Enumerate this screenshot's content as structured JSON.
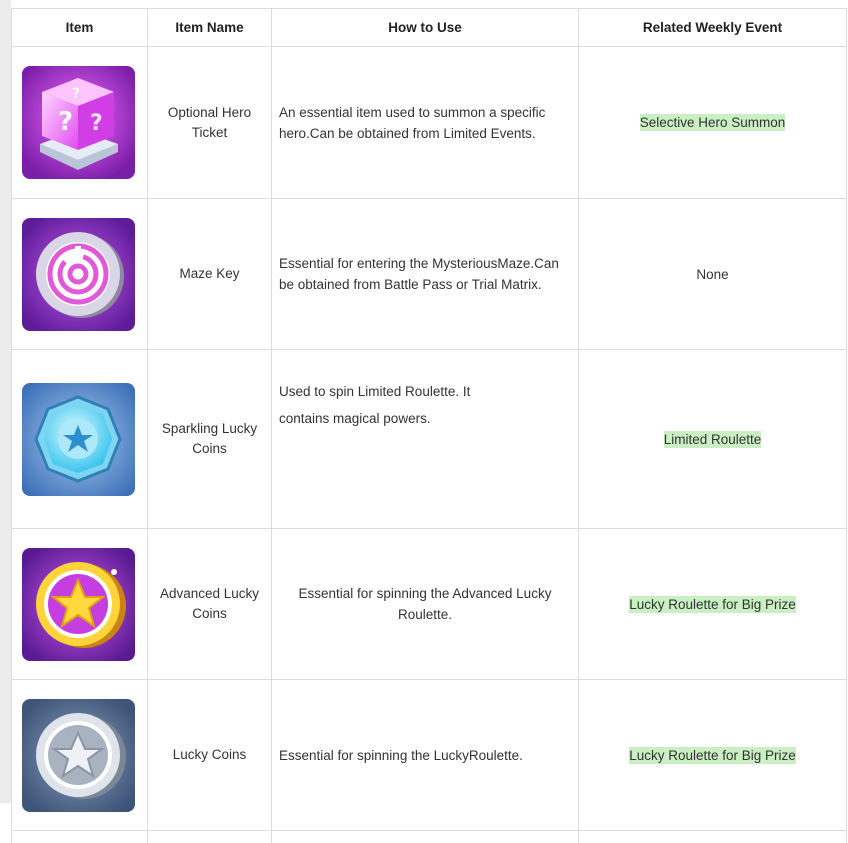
{
  "headers": {
    "item": "Item",
    "item_name": "Item Name",
    "how_to_use": "How to Use",
    "related_event": "Related Weekly Event"
  },
  "rows": [
    {
      "icon": "purple-cube-ticket-icon",
      "name": "Optional Hero Ticket",
      "use": "An essential item used to summon a specific hero.Can be obtained from Limited Events.",
      "event": "Selective Hero Summon",
      "event_highlight": true
    },
    {
      "icon": "maze-key-icon",
      "name": "Maze Key",
      "use": "Essential for entering the MysteriousMaze.Can be obtained from Battle Pass or Trial Matrix.",
      "event": "None",
      "event_highlight": false
    },
    {
      "icon": "sparkling-coin-icon",
      "name": "Sparkling Lucky Coins",
      "use_line1": "Used to spin Limited Roulette. It",
      "use_line2": "contains magical powers.",
      "event": "Limited Roulette",
      "event_highlight": true
    },
    {
      "icon": "gold-star-coin-icon",
      "name": "Advanced Lucky Coins",
      "use": "Essential for spinning the Advanced Lucky Roulette.",
      "event": "Lucky Roulette for Big Prize",
      "event_highlight": true
    },
    {
      "icon": "silver-star-coin-icon",
      "name": "Lucky Coins",
      "use": "Essential for spinning the LuckyRoulette.",
      "event": "Lucky Roulette for Big Prize",
      "event_highlight": true
    }
  ],
  "colors": {
    "highlight": "#c9efc2",
    "border": "#dcdcdc"
  }
}
